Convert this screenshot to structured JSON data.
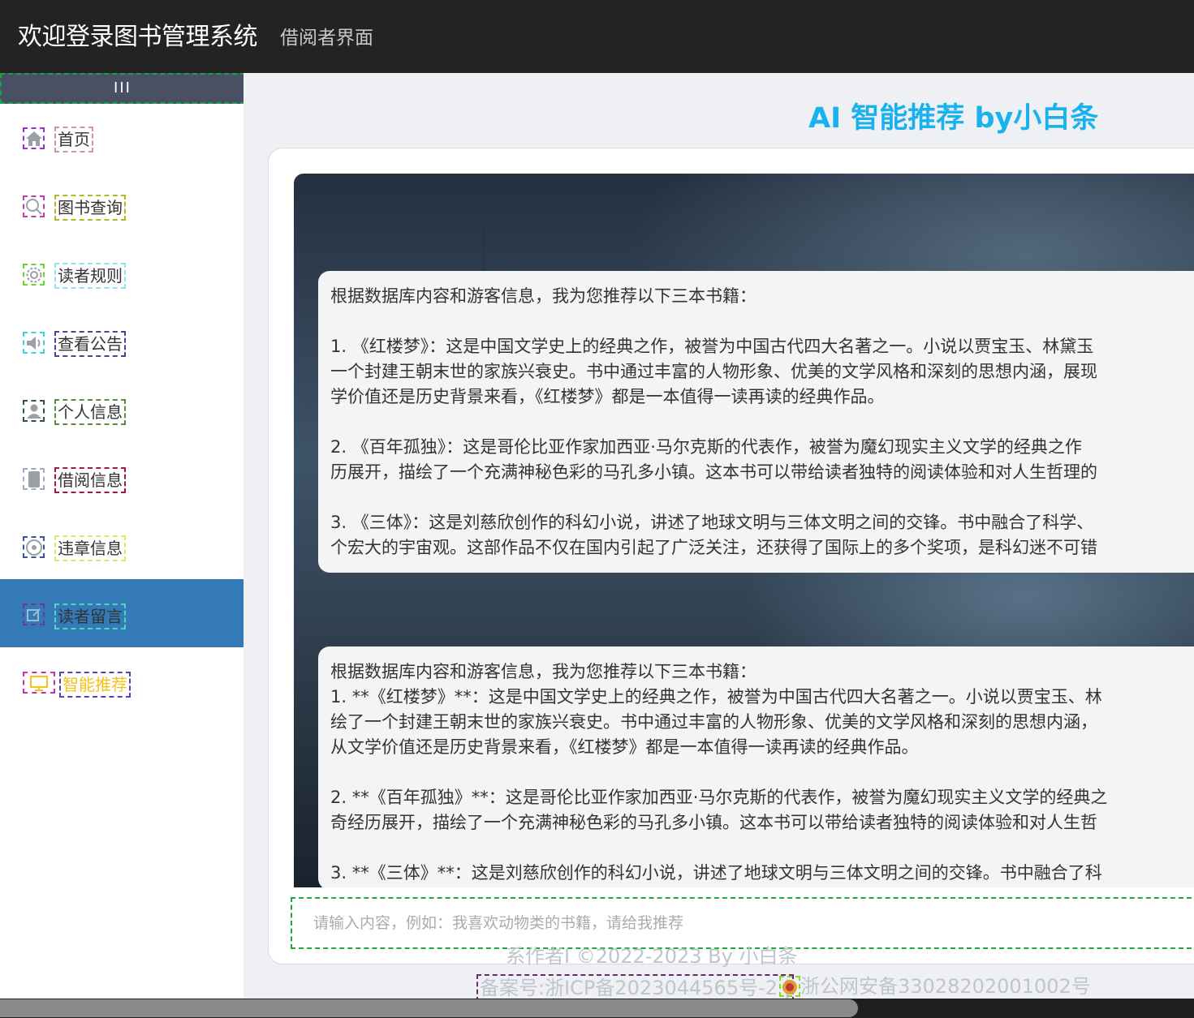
{
  "header": {
    "title": "欢迎登录图书管理系统",
    "subtitle": "借阅者界面"
  },
  "sidebar": {
    "collapse_label": "III",
    "items": [
      {
        "label": "首页",
        "icon": "home-icon"
      },
      {
        "label": "图书查询",
        "icon": "search-icon"
      },
      {
        "label": "读者规则",
        "icon": "settings-icon"
      },
      {
        "label": "查看公告",
        "icon": "speaker-icon"
      },
      {
        "label": "个人信息",
        "icon": "user-icon"
      },
      {
        "label": "借阅信息",
        "icon": "phone-icon"
      },
      {
        "label": "违章信息",
        "icon": "violation-icon"
      },
      {
        "label": "读者留言",
        "icon": "edit-icon"
      },
      {
        "label": "智能推荐",
        "icon": "monitor-icon"
      }
    ],
    "active_item": "读者留言"
  },
  "main": {
    "heading": "AI 智能推荐 by小白条",
    "messages": [
      "根据数据库内容和游客信息，我为您推荐以下三本书籍：\n\n1. 《红楼梦》：这是中国文学史上的经典之作，被誉为中国古代四大名著之一。小说以贾宝玉、林黛玉\n一个封建王朝末世的家族兴衰史。书中通过丰富的人物形象、优美的文学风格和深刻的思想内涵，展现\n学价值还是历史背景来看，《红楼梦》都是一本值得一读再读的经典作品。\n\n2. 《百年孤独》：这是哥伦比亚作家加西亚·马尔克斯的代表作，被誉为魔幻现实主义文学的经典之作\n历展开，描绘了一个充满神秘色彩的马孔多小镇。这本书可以带给读者独特的阅读体验和对人生哲理的\n\n3. 《三体》：这是刘慈欣创作的科幻小说，讲述了地球文明与三体文明之间的交锋。书中融合了科学、\n个宏大的宇宙观。这部作品不仅在国内引起了广泛关注，还获得了国际上的多个奖项，是科幻迷不可错",
      "根据数据库内容和游客信息，我为您推荐以下三本书籍：\n1. **《红楼梦》**：这是中国文学史上的经典之作，被誉为中国古代四大名著之一。小说以贾宝玉、林\n绘了一个封建王朝末世的家族兴衰史。书中通过丰富的人物形象、优美的文学风格和深刻的思想内涵，\n从文学价值还是历史背景来看，《红楼梦》都是一本值得一读再读的经典作品。\n\n2. **《百年孤独》**：这是哥伦比亚作家加西亚·马尔克斯的代表作，被誉为魔幻现实主义文学的经典之\n奇经历展开，描绘了一个充满神秘色彩的马孔多小镇。这本书可以带给读者独特的阅读体验和对人生哲\n\n3. **《三体》**：这是刘慈欣创作的科幻小说，讲述了地球文明与三体文明之间的交锋。书中融合了科"
    ],
    "input_placeholder": "请输入内容，例如：我喜欢动物类的书籍，请给我推荐",
    "footer_author": "系作者I ©2022-2023 By 小白条",
    "footer_icp": "备案号:浙ICP备2023044565号-2 |",
    "footer_police": "浙公网安备33028202001002号"
  },
  "colors": {
    "header_bg": "#232323",
    "active_bg": "#337ab7",
    "heading": "#1ab2ee",
    "highlight_label": "#f4c21b"
  }
}
